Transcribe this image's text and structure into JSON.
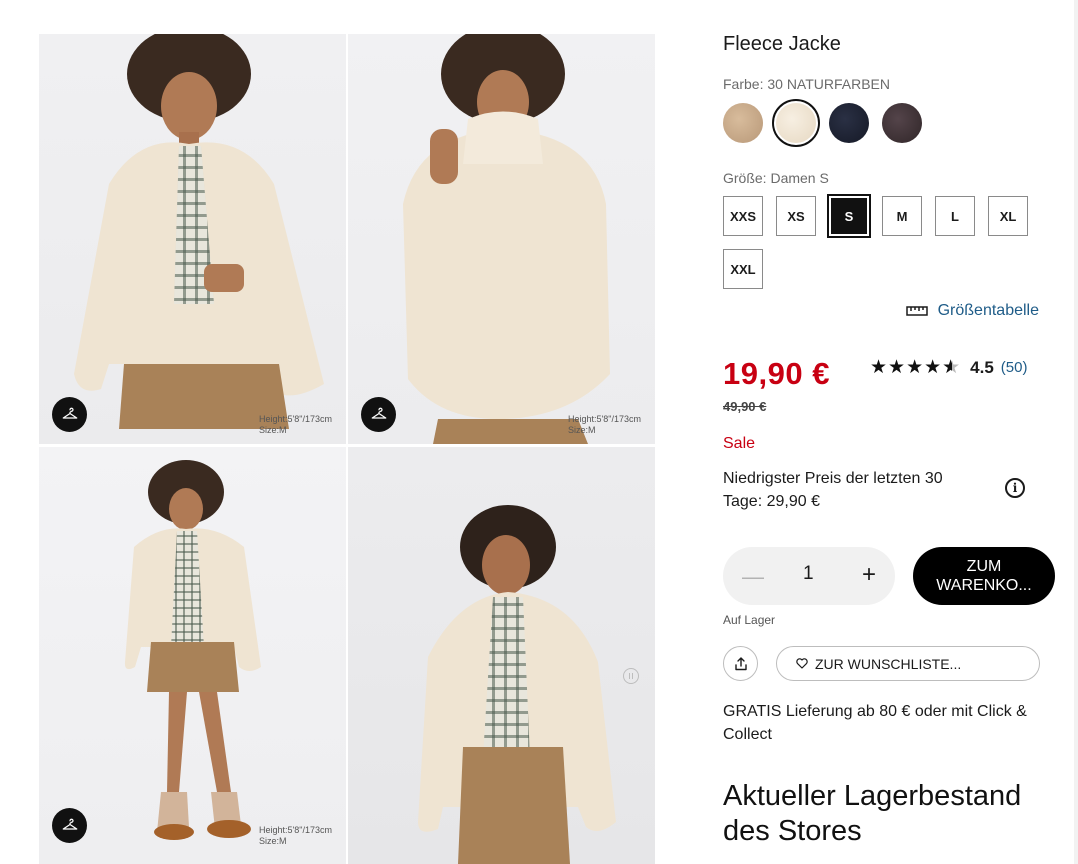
{
  "product": {
    "title": "Fleece Jacke",
    "color_label": "Farbe: 30 NATURFARBEN",
    "colors": [
      {
        "name": "beige",
        "hex": "#c8a888"
      },
      {
        "name": "naturfarben",
        "hex": "#efe4d2",
        "selected": true
      },
      {
        "name": "navy",
        "hex": "#1d2233"
      },
      {
        "name": "dunkelbraun",
        "hex": "#3f3233"
      }
    ],
    "size_label": "Größe: Damen S",
    "sizes": [
      {
        "label": "XXS"
      },
      {
        "label": "XS"
      },
      {
        "label": "S",
        "selected": true
      },
      {
        "label": "M"
      },
      {
        "label": "L"
      },
      {
        "label": "XL"
      },
      {
        "label": "XXL"
      }
    ],
    "size_chart_label": "Größentabelle",
    "price": "19,90 €",
    "old_price": "49,90 €",
    "rating_value": "4.5",
    "rating_stars": 4.5,
    "rating_count": "(50)",
    "sale_label": "Sale",
    "lowest_price_text": "Niedrigster Preis der letzten 30 Tage: 29,90 €",
    "quantity": "1",
    "cart_button": "ZUM WARENKO...",
    "stock_status": "Auf Lager",
    "wishlist_button": "ZUR WUNSCHLISTE...",
    "delivery_text": "GRATIS Lieferung ab 80 € oder mit Click & Collect",
    "store_stock_heading": "Aktueller Lagerbestand des Stores"
  },
  "gallery": {
    "model_info": {
      "height": "Height:5'8\"/173cm",
      "size": "Size:M"
    }
  },
  "colors": {
    "price_red": "#c80012",
    "link_blue": "#1f5c88",
    "jacket_cream": "#efe4d2",
    "skirt_brown": "#a98258"
  }
}
